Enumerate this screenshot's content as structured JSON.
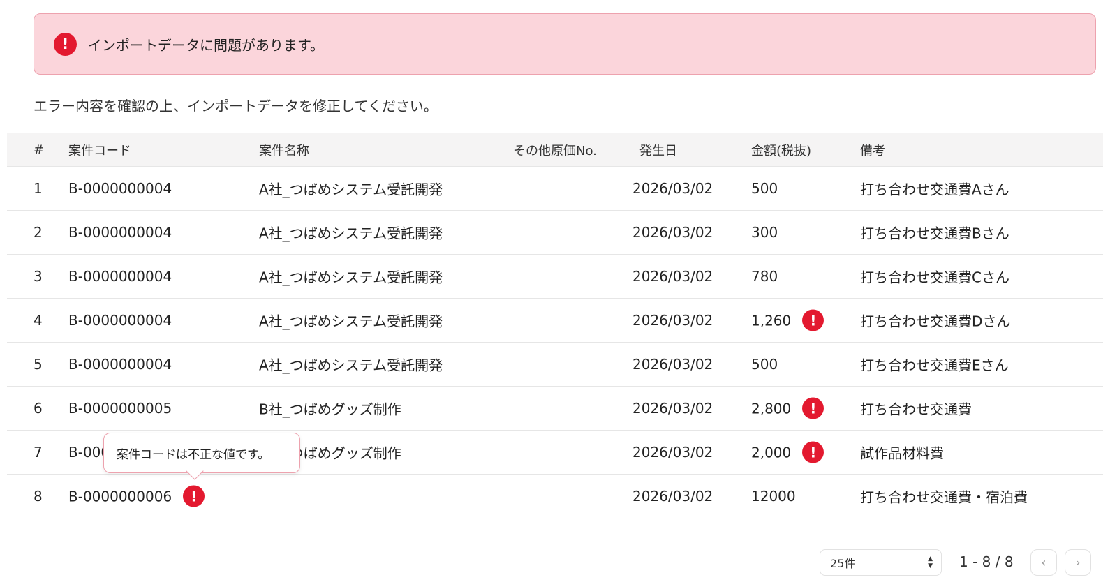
{
  "alert": {
    "icon": "exclamation-circle-icon",
    "message": "インポートデータに問題があります。",
    "color": "#e3192f"
  },
  "instruction": "エラー内容を確認の上、インポートデータを修正してください。",
  "table": {
    "headers": {
      "num": "#",
      "code": "案件コード",
      "name": "案件名称",
      "other_cost_no": "その他原価No.",
      "date": "発生日",
      "amount": "金額(税抜)",
      "note": "備考"
    },
    "rows": [
      {
        "num": "1",
        "code": "B-0000000004",
        "name": "A社_つばめシステム受託開発",
        "other_cost_no": "",
        "date": "2026/03/02",
        "amount": "500",
        "note": "打ち合わせ交通費Aさん"
      },
      {
        "num": "2",
        "code": "B-0000000004",
        "name": "A社_つばめシステム受託開発",
        "other_cost_no": "",
        "date": "2026/03/02",
        "amount": "300",
        "note": "打ち合わせ交通費Bさん"
      },
      {
        "num": "3",
        "code": "B-0000000004",
        "name": "A社_つばめシステム受託開発",
        "other_cost_no": "",
        "date": "2026/03/02",
        "amount": "780",
        "note": "打ち合わせ交通費Cさん"
      },
      {
        "num": "4",
        "code": "B-0000000004",
        "name": "A社_つばめシステム受託開発",
        "other_cost_no": "",
        "date": "2026/03/02",
        "amount": "1,260",
        "note": "打ち合わせ交通費Dさん"
      },
      {
        "num": "5",
        "code": "B-0000000004",
        "name": "A社_つばめシステム受託開発",
        "other_cost_no": "",
        "date": "2026/03/02",
        "amount": "500",
        "note": "打ち合わせ交通費Eさん"
      },
      {
        "num": "6",
        "code": "B-0000000005",
        "name": "B社_つばめグッズ制作",
        "other_cost_no": "",
        "date": "2026/03/02",
        "amount": "2,800",
        "note": "打ち合わせ交通費"
      },
      {
        "num": "7",
        "code": "B-0000000005",
        "name": "B社_つばめグッズ制作",
        "other_cost_no": "",
        "date": "2026/03/02",
        "amount": "2,000",
        "note": "試作品材料費"
      },
      {
        "num": "8",
        "code": "B-0000000006",
        "name": "",
        "other_cost_no": "",
        "date": "2026/03/02",
        "amount": "12000",
        "note": "打ち合わせ交通費・宿泊費"
      }
    ]
  },
  "tooltip": {
    "message": "案件コードは不正な値です。"
  },
  "pagination": {
    "per_page": "25件",
    "range": "1 - 8 / 8",
    "prev_icon": "chevron-left-icon",
    "next_icon": "chevron-right-icon"
  }
}
